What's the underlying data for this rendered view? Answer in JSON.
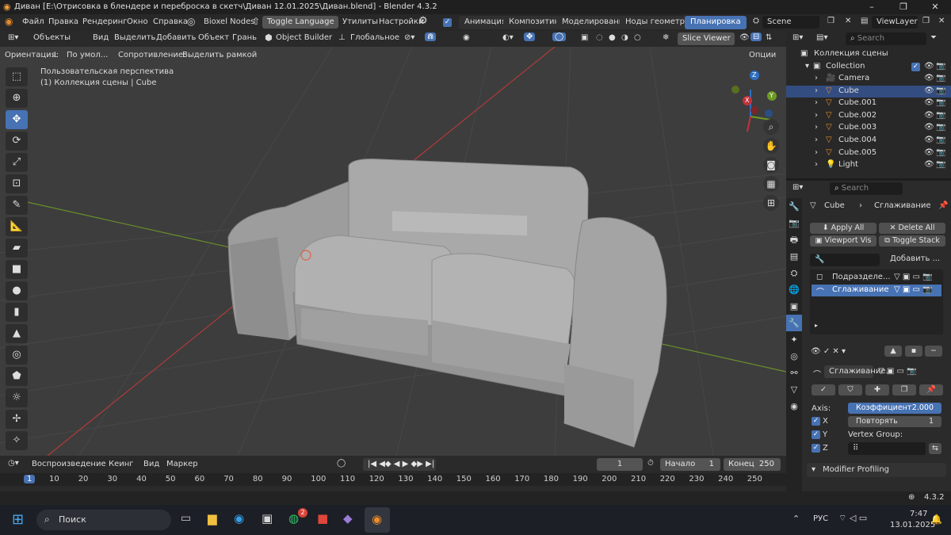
{
  "title_bar": {
    "text": "Диван [E:\\Отрисовка в блендере и переброска в скетч\\Диван 12.01.2025\\Диван.blend] - Blender 4.3.2",
    "minimize": "–",
    "maximize": "❐",
    "close": "✕"
  },
  "menu": {
    "items": [
      "Файл",
      "Правка",
      "Рендеринг",
      "Окно",
      "Справка"
    ],
    "bioxel": "Bioxel Nodes",
    "toggle_language": "Toggle Language",
    "utilities": "Утилиты",
    "settings": "Настройки",
    "workspaces": [
      "Анимация",
      "Композитинг",
      "Моделирование",
      "Ноды геометрии",
      "Планировка"
    ],
    "active_workspace": "Планировка",
    "scene": "Scene",
    "view_layer": "ViewLayer"
  },
  "viewport_header": {
    "mode": "Объекты",
    "menus": [
      "Вид",
      "Выделить",
      "Добавить",
      "Объект",
      "Грань"
    ],
    "object_builder": "Object Builder",
    "transform_orientation": "Глобальное",
    "slice_viewer": "Slice Viewer"
  },
  "tool_settings": {
    "orientation_label": "Ориентация:",
    "orientation_value": "По умол...",
    "drag_label": "Сопротивление:",
    "drag_value": "Выделить рамкой",
    "options": "Опции"
  },
  "viewport_overlay": {
    "line1": "Пользовательская перспектива",
    "line2": "(1) Коллекция сцены | Cube"
  },
  "gizmo": {
    "x": "X",
    "y": "Y",
    "z": "Z"
  },
  "timeline": {
    "menus": [
      "Воспроизведение",
      "Кеинг",
      "Вид",
      "Маркер"
    ],
    "current_frame": "1",
    "start_label": "Начало",
    "start": "1",
    "end_label": "Конец",
    "end": "250",
    "ticks": [
      "1",
      "10",
      "20",
      "30",
      "40",
      "50",
      "60",
      "70",
      "80",
      "90",
      "100",
      "110",
      "120",
      "130",
      "140",
      "150",
      "160",
      "170",
      "180",
      "190",
      "200",
      "210",
      "220",
      "230",
      "240",
      "250"
    ]
  },
  "outliner": {
    "search_placeholder": "Search",
    "root": "Коллекция сцены",
    "collection": "Collection",
    "items": [
      {
        "name": "Camera",
        "selected": false,
        "icon": "camera-icon"
      },
      {
        "name": "Cube",
        "selected": true,
        "icon": "mesh-icon"
      },
      {
        "name": "Cube.001",
        "selected": false,
        "icon": "mesh-icon"
      },
      {
        "name": "Cube.002",
        "selected": false,
        "icon": "mesh-icon"
      },
      {
        "name": "Cube.003",
        "selected": false,
        "icon": "mesh-icon"
      },
      {
        "name": "Cube.004",
        "selected": false,
        "icon": "mesh-icon"
      },
      {
        "name": "Cube.005",
        "selected": false,
        "icon": "mesh-icon"
      },
      {
        "name": "Light",
        "selected": false,
        "icon": "light-icon"
      }
    ]
  },
  "properties": {
    "search_placeholder": "Search",
    "breadcrumb_object": "Cube",
    "breadcrumb_modifier": "Сглаживание",
    "apply_all": "Apply All",
    "delete_all": "Delete All",
    "viewport_vis": "Viewport Vis",
    "toggle_stack": "Toggle Stack",
    "add_modifier": "Добавить ...",
    "modifiers": [
      {
        "name": "Подразделе...",
        "selected": false
      },
      {
        "name": "Сглаживание",
        "selected": true
      }
    ],
    "active_modifier_name": "Сглаживание...",
    "axis_label": "Axis:",
    "factor_label": "Коэффициент",
    "factor_value": "2.000",
    "repeat_label": "Повторять",
    "repeat_value": "1",
    "axes": [
      "X",
      "Y",
      "Z"
    ],
    "vertex_group_label": "Vertex Group:",
    "profiling": "Modifier Profiling"
  },
  "status": {
    "version": "4.3.2"
  },
  "taskbar": {
    "search_placeholder": "Поиск",
    "whatsapp_badge": "2",
    "language": "РУС",
    "time": "7:47",
    "date": "13.01.2025"
  },
  "colors": {
    "accent": "#4772b3",
    "viewport_bg": "#3d3d3d",
    "panel_bg": "#2b2b2b",
    "sofa": "#a8a8a8",
    "x_axis": "#c3323b",
    "y_axis": "#6e9a26",
    "z_axis": "#2d6fc4"
  }
}
